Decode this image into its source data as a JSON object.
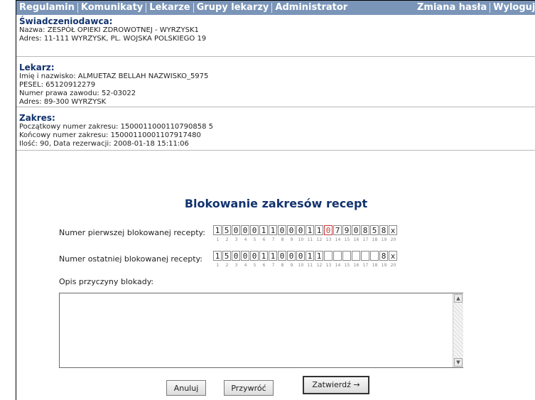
{
  "nav": {
    "items": [
      "Regulamin",
      "Komunikaty",
      "Lekarze",
      "Grupy lekarzy",
      "Administrator"
    ],
    "right": [
      "Zmiana hasła",
      "Wyloguj"
    ]
  },
  "provider": {
    "title": "Świadczeniodawca:",
    "lines": [
      "Nazwa: ZESPÓŁ OPIEKI ZDROWOTNEJ - WYRZYSK1",
      "Adres: 11-111 WYRZYSK, PL. WOJSKA POLSKIEGO 19"
    ]
  },
  "doctor": {
    "title": "Lekarz:",
    "lines": [
      "Imię i nazwisko: ALMUETAZ BELLAH NAZWISKO_5975",
      "PESEL: 65120912279",
      "Numer prawa zawodu: 52-03022",
      "Adres: 89-300 WYRZYSK"
    ]
  },
  "range": {
    "title": "Zakres:",
    "lines": [
      "Początkowy numer zakresu: 1500011000110790858 5",
      "Końcowy numer zakresu: 15000110001107917480",
      "Ilość: 90,   Data rezerwacji: 2008-01-18 15:11:06"
    ]
  },
  "form": {
    "title": "Blokowanie zakresów recept",
    "first_label": "Numer pierwszej blokowanej recepty:",
    "first_digits": [
      "1",
      "5",
      "0",
      "0",
      "0",
      "1",
      "1",
      "0",
      "0",
      "0",
      "1",
      "1",
      "0",
      "7",
      "9",
      "0",
      "8",
      "5",
      "8",
      "x"
    ],
    "first_highlight_index": 12,
    "last_label": "Numer ostatniej blokowanej recepty:",
    "last_digits": [
      "1",
      "5",
      "0",
      "0",
      "0",
      "1",
      "1",
      "0",
      "0",
      "0",
      "1",
      "1",
      "",
      "",
      "",
      "",
      "",
      "",
      "8",
      "x"
    ],
    "position_numbers": [
      "1",
      "2",
      "3",
      "4",
      "5",
      "6",
      "7",
      "8",
      "9",
      "10",
      "11",
      "12",
      "13",
      "14",
      "15",
      "16",
      "17",
      "18",
      "19",
      "20"
    ],
    "reason_label": "Opis przyczyny blokady:",
    "reason_value": ""
  },
  "buttons": {
    "cancel": "Anuluj",
    "restore": "Przywróć",
    "confirm": "Zatwierdź →"
  }
}
